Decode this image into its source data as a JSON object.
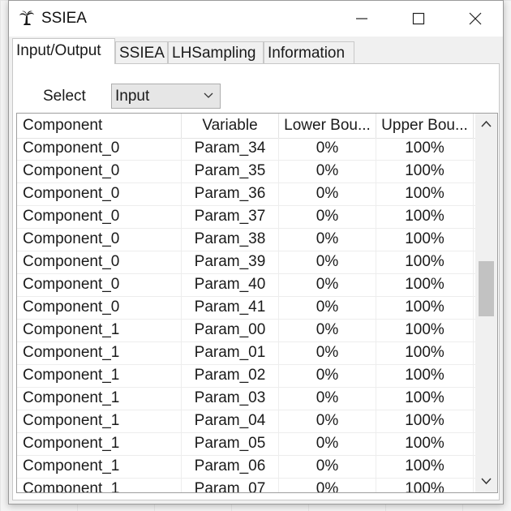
{
  "window": {
    "title": "SSIEA",
    "app_icon": "palm-tree-icon"
  },
  "tabs": [
    {
      "label": "Input/Output",
      "active": true
    },
    {
      "label": "SSIEA",
      "active": false
    },
    {
      "label": "LHSampling",
      "active": false
    },
    {
      "label": "Information",
      "active": false
    }
  ],
  "select": {
    "label": "Select",
    "value": "Input"
  },
  "table": {
    "columns": [
      "Component",
      "Variable",
      "Lower Bou...",
      "Upper Bou..."
    ],
    "rows": [
      [
        "Component_0",
        "Param_34",
        "0%",
        "100%"
      ],
      [
        "Component_0",
        "Param_35",
        "0%",
        "100%"
      ],
      [
        "Component_0",
        "Param_36",
        "0%",
        "100%"
      ],
      [
        "Component_0",
        "Param_37",
        "0%",
        "100%"
      ],
      [
        "Component_0",
        "Param_38",
        "0%",
        "100%"
      ],
      [
        "Component_0",
        "Param_39",
        "0%",
        "100%"
      ],
      [
        "Component_0",
        "Param_40",
        "0%",
        "100%"
      ],
      [
        "Component_0",
        "Param_41",
        "0%",
        "100%"
      ],
      [
        "Component_1",
        "Param_00",
        "0%",
        "100%"
      ],
      [
        "Component_1",
        "Param_01",
        "0%",
        "100%"
      ],
      [
        "Component_1",
        "Param_02",
        "0%",
        "100%"
      ],
      [
        "Component_1",
        "Param_03",
        "0%",
        "100%"
      ],
      [
        "Component_1",
        "Param_04",
        "0%",
        "100%"
      ],
      [
        "Component_1",
        "Param_05",
        "0%",
        "100%"
      ],
      [
        "Component_1",
        "Param_06",
        "0%",
        "100%"
      ],
      [
        "Component_1",
        "Param_07",
        "0%",
        "100%"
      ]
    ]
  }
}
